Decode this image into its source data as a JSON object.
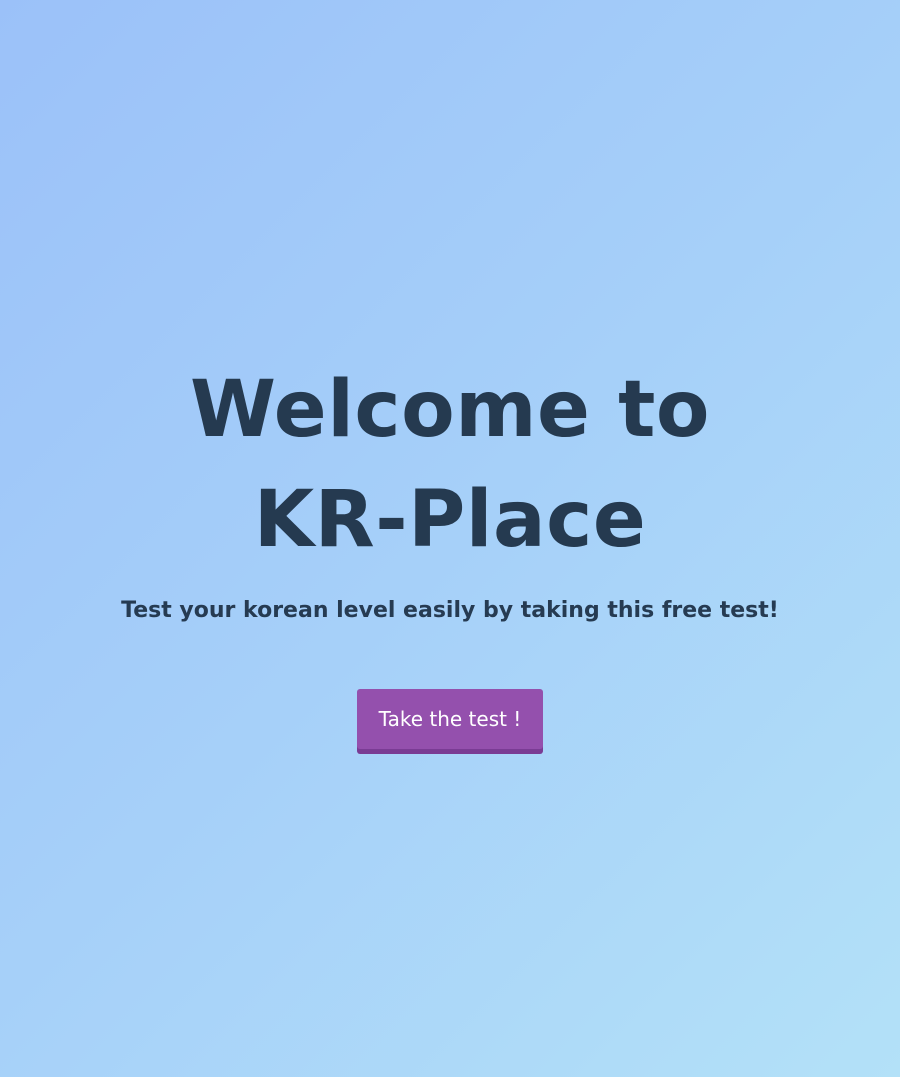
{
  "hero": {
    "title": "Welcome to KR-Place",
    "subtitle": "Test your korean level easily by taking this free test!",
    "cta_label": "Take the test !"
  },
  "colors": {
    "text": "#253a50",
    "button": "#9450ad",
    "button_shadow": "#7a3c94",
    "background_start": "#9bc1f9",
    "background_end": "#b3e1f8"
  }
}
